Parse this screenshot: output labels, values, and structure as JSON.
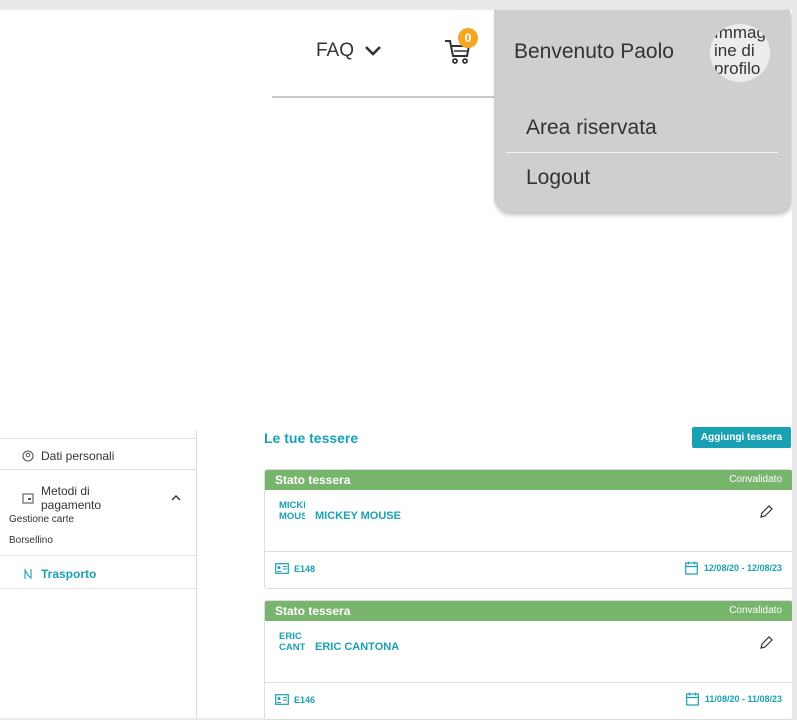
{
  "header": {
    "faq_label": "FAQ",
    "cart_count": "0"
  },
  "user_menu": {
    "welcome": "Benvenuto Paolo",
    "avatar_alt_text": "Immagine di profilo",
    "items": [
      {
        "label": "Area riservata"
      },
      {
        "label": "Logout"
      }
    ]
  },
  "sidebar": {
    "personal": "Dati personali",
    "payment": "Metodi di pagamento",
    "payment_sub": [
      "Gestione carte",
      "Borsellino"
    ],
    "transport": "Trasporto"
  },
  "main": {
    "title": "Le tue tessere",
    "add_button": "Aggiungi tessera",
    "cards": [
      {
        "status_label": "Stato tessera",
        "status_value": "Convalidato",
        "logo_text": "MICKEY MOUSE",
        "holder": "MICKEY MOUSE",
        "code": "E148",
        "validity": "12/08/20 - 12/08/23"
      },
      {
        "status_label": "Stato tessera",
        "status_value": "Convalidato",
        "logo_text": "ERIC CANTONA",
        "holder": "ERIC CANTONA",
        "code": "E146",
        "validity": "11/08/20 - 11/08/23"
      }
    ]
  },
  "colors": {
    "accent": "#19a1b3",
    "status_green": "#77b56d",
    "badge": "#f5a623",
    "dropdown_bg": "#cfcfcf"
  },
  "icons": [
    "chevron-down-icon",
    "cart-icon",
    "user-circle-icon",
    "wallet-icon",
    "chevron-up-icon",
    "transport-icon",
    "pencil-icon",
    "id-card-icon",
    "calendar-icon"
  ]
}
